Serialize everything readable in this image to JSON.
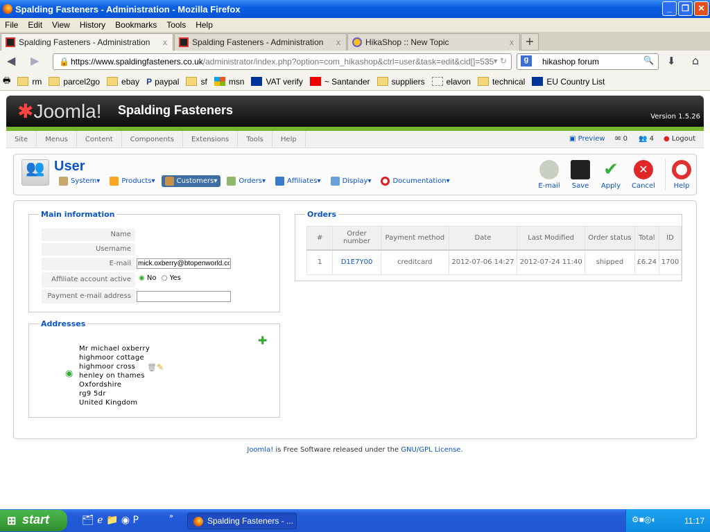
{
  "window": {
    "title": "Spalding Fasteners - Administration - Mozilla Firefox"
  },
  "menu": [
    "File",
    "Edit",
    "View",
    "History",
    "Bookmarks",
    "Tools",
    "Help"
  ],
  "tabs": [
    {
      "label": "Spalding Fasteners - Administration"
    },
    {
      "label": "Spalding Fasteners - Administration"
    },
    {
      "label": "HikaShop :: New Topic"
    }
  ],
  "nav": {
    "url_host": "https://www.spaldingfasteners.co.uk",
    "url_path": "/administrator/index.php?option=com_hikashop&ctrl=user&task=edit&cid[]=535",
    "search": "hikashop forum"
  },
  "bookmarks": [
    "rm",
    "parcel2go",
    "ebay",
    "paypal",
    "sf",
    "msn",
    "VAT verify",
    "~ Santander",
    "suppliers",
    "elavon",
    "technical",
    "EU Country List"
  ],
  "joomla": {
    "logo": "Joomla!",
    "site": "Spalding Fasteners",
    "version": "Version 1.5.26",
    "menu": [
      "Site",
      "Menus",
      "Content",
      "Components",
      "Extensions",
      "Tools",
      "Help"
    ],
    "status": {
      "preview": "Preview",
      "messages": "0",
      "users": "4",
      "logout": "Logout"
    }
  },
  "page": {
    "title": "User",
    "submenu": [
      {
        "label": "System",
        "color": "#c9a66b"
      },
      {
        "label": "Products",
        "color": "#f5a623"
      },
      {
        "label": "Customers",
        "color": "#c8904a",
        "active": true
      },
      {
        "label": "Orders",
        "color": "#8fb86a"
      },
      {
        "label": "Affiliates",
        "color": "#3a7ac8"
      },
      {
        "label": "Display",
        "color": "#6aa0d8"
      },
      {
        "label": "Documentation",
        "color": "#e02020"
      }
    ],
    "toolbar": [
      {
        "label": "E-mail",
        "color": "#b7c4b0"
      },
      {
        "label": "Save",
        "color": "#222222"
      },
      {
        "label": "Apply",
        "color": "#3ab03a"
      },
      {
        "label": "Cancel",
        "color": "#e02828"
      },
      {
        "label": "Help",
        "color": "#e03030"
      }
    ]
  },
  "main_info": {
    "legend": "Main information",
    "name_label": "Name",
    "username_label": "Username",
    "email_label": "E-mail",
    "email_value": "mick.oxberry@btopenworld.com",
    "affiliate_label": "Affiliate account active",
    "no": "No",
    "yes": "Yes",
    "affiliate_value": "No",
    "payment_label": "Payment e-mail address",
    "payment_value": ""
  },
  "addresses": {
    "legend": "Addresses",
    "lines": [
      "Mr michael oxberry",
      "highmoor cottage",
      "highmoor cross",
      "henley on thames",
      "Oxfordshire",
      "rg9 5dr",
      "United Kingdom"
    ]
  },
  "orders": {
    "legend": "Orders",
    "columns": [
      "#",
      "Order number",
      "Payment method",
      "Date",
      "Last Modified",
      "Order status",
      "Total",
      "ID"
    ],
    "rows": [
      [
        "1",
        "D1E7Y00",
        "creditcard",
        "2012-07-06 14:27",
        "2012-07-24 11:40",
        "shipped",
        "£6.24",
        "1700"
      ]
    ]
  },
  "footer": {
    "joomla": "Joomla!",
    "text1": " is Free Software released under the ",
    "license": "GNU/GPL License",
    "text2": "."
  },
  "taskbar": {
    "start": "start",
    "task": "Spalding Fasteners - ...",
    "clock": "11:17"
  }
}
